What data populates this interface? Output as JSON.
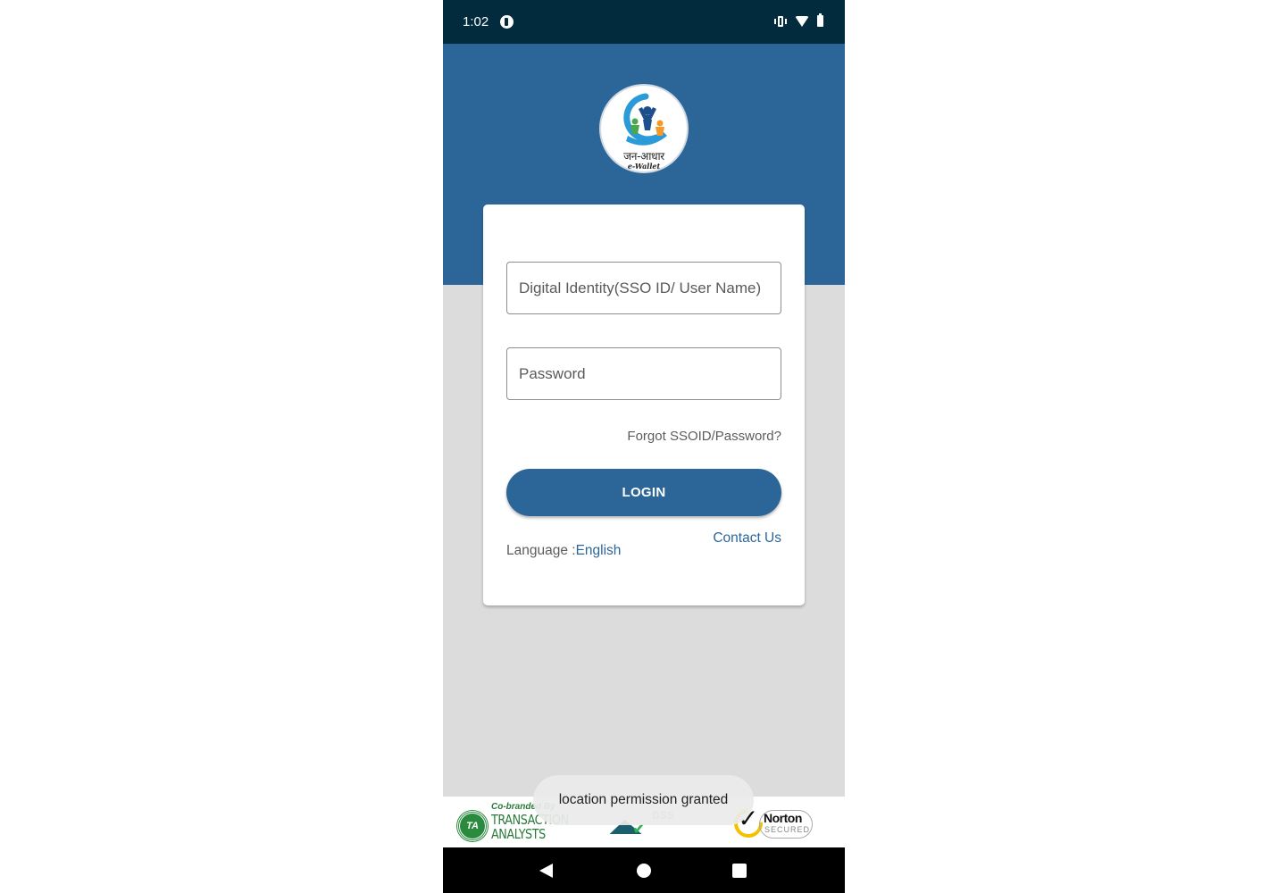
{
  "status_bar": {
    "time": "1:02",
    "icons": [
      "app-notification-icon",
      "vibrate-icon",
      "wifi-icon",
      "battery-icon"
    ]
  },
  "logo": {
    "title_hindi": "जन-आधार",
    "subtitle": "e-Wallet"
  },
  "login_form": {
    "username_placeholder": "Digital Identity(SSO ID/ User Name)",
    "username_value": "",
    "password_placeholder": "Password",
    "password_value": "",
    "forgot_link": "Forgot SSOID/Password?",
    "login_button": "LOGIN",
    "contact_link": "Contact Us",
    "language_label": "Language :",
    "language_value": "English"
  },
  "footer": {
    "cobrand_text": "Co-branded By",
    "ta_seal": "TA",
    "ta_name_line1": "TRANSACTION",
    "ta_name_line2": "ANALYSTS",
    "pci_text": "DSS",
    "norton_name": "Norton",
    "norton_secured": "SECURED"
  },
  "toast": {
    "message": "location permission granted"
  },
  "nav_bar": {
    "buttons": [
      "back",
      "home",
      "recents"
    ]
  },
  "colors": {
    "primary": "#2c6699",
    "status_bar": "#022c3e",
    "background": "#dcdcdc"
  }
}
